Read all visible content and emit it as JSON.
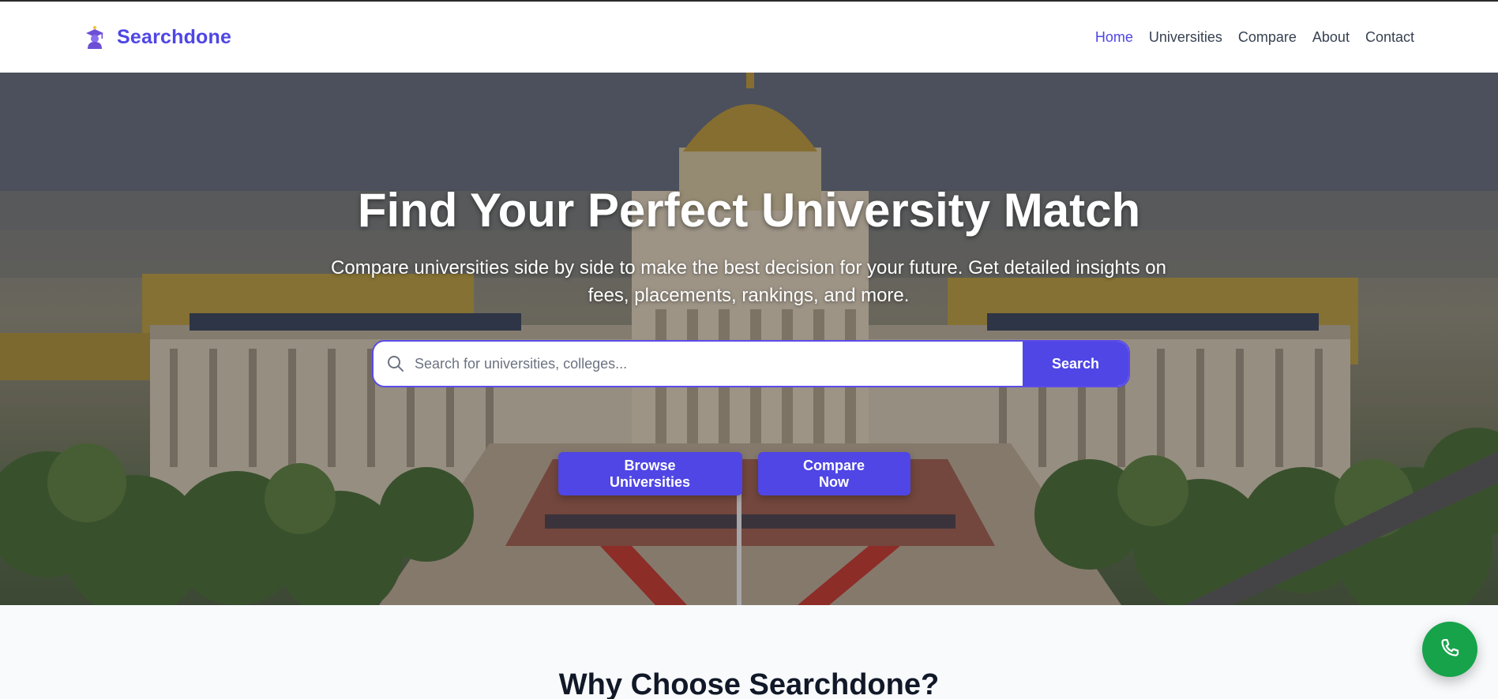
{
  "brand": {
    "name": "Searchdone",
    "logo_icon": "graduate-icon"
  },
  "nav": {
    "items": [
      {
        "label": "Home",
        "active": true
      },
      {
        "label": "Universities",
        "active": false
      },
      {
        "label": "Compare",
        "active": false
      },
      {
        "label": "About",
        "active": false
      },
      {
        "label": "Contact",
        "active": false
      }
    ]
  },
  "hero": {
    "title": "Find Your Perfect University Match",
    "subtitle": "Compare universities side by side to make the best decision for your future. Get detailed insights on fees, placements, rankings, and more.",
    "search": {
      "placeholder": "Search for universities, colleges...",
      "value": "",
      "button_label": "Search",
      "icon": "search-icon"
    },
    "browse_label": "Browse Universities",
    "compare_label": "Compare Now"
  },
  "why": {
    "title": "Why Choose Searchdone?"
  },
  "fab": {
    "icon": "phone-icon"
  },
  "colors": {
    "accent": "#4f46e5",
    "nav_text": "#374151",
    "fab": "#16a34a"
  }
}
